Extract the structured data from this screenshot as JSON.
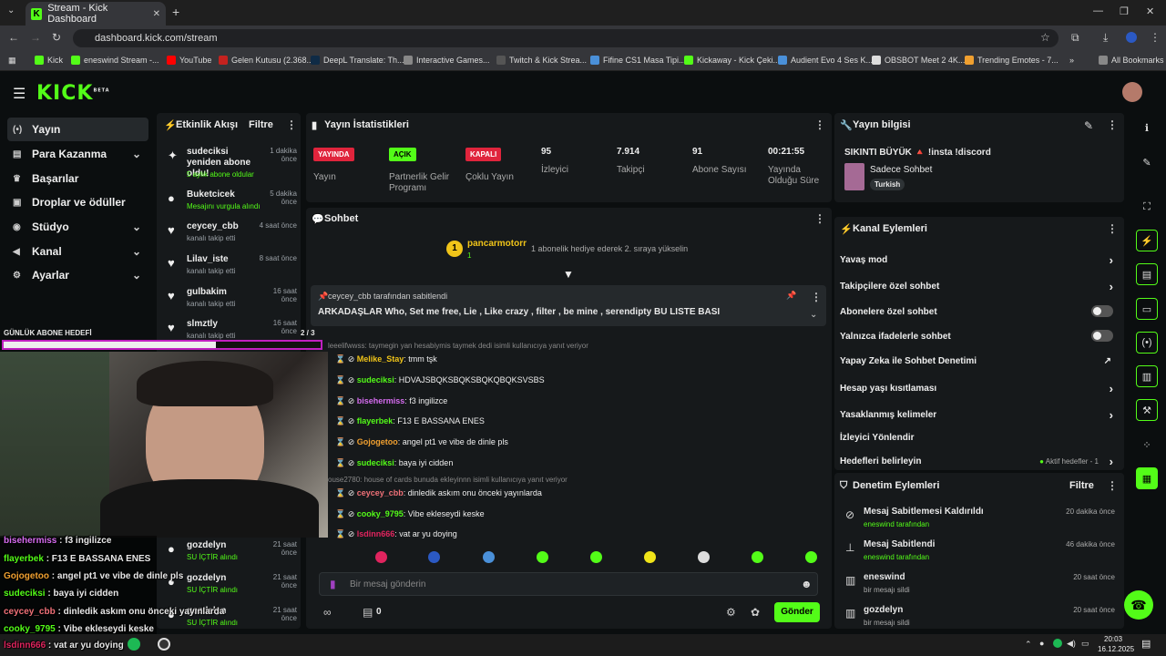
{
  "browser": {
    "tab_title": "Stream - Kick Dashboard",
    "url": "dashboard.kick.com/stream",
    "bookmarks": [
      "Kick",
      "eneswind Stream -...",
      "YouTube",
      "Gelen Kutusu (2.368...",
      "DeepL Translate: Th...",
      "Interactive Games...",
      "Twitch & Kick Strea...",
      "Fifine CS1 Masa Tipi...",
      "Kickaway - Kick Çeki...",
      "Audient Evo 4 Ses K...",
      "OBSBOT Meet 2 4K...",
      "Trending Emotes - 7..."
    ],
    "all_bookmarks": "All Bookmarks"
  },
  "logo": "KICK",
  "logo_beta": "BETA",
  "sidebar": {
    "items": [
      {
        "label": "Yayın",
        "icon": "broadcast-icon",
        "chev": ""
      },
      {
        "label": "Para Kazanma",
        "icon": "wallet-icon",
        "chev": "⌄"
      },
      {
        "label": "Başarılar",
        "icon": "trophy-icon",
        "chev": ""
      },
      {
        "label": "Droplar ve ödüller",
        "icon": "gift-icon",
        "chev": ""
      },
      {
        "label": "Stüdyo",
        "icon": "palette-icon",
        "chev": "⌄"
      },
      {
        "label": "Kanal",
        "icon": "megaphone-icon",
        "chev": "⌄"
      },
      {
        "label": "Ayarlar",
        "icon": "gear-icon",
        "chev": "⌄"
      }
    ]
  },
  "activity": {
    "title": "Etkinlik Akışı",
    "filter": "Filtre",
    "items": [
      {
        "name": "sudeciksi yeniden abone oldu!",
        "time": "1 dakika önce",
        "sub": "5 aylık abone oldular",
        "subcolor": "#53fc18"
      },
      {
        "name": "Buketcicek",
        "time": "5 dakika önce",
        "sub": "Mesajını vurgula alındı",
        "subcolor": "#53fc18"
      },
      {
        "name": "ceycey_cbb",
        "time": "4 saat önce",
        "sub": "kanalı takip etti",
        "subcolor": "#9aa0a6"
      },
      {
        "name": "Lilav_iste",
        "time": "8 saat önce",
        "sub": "kanalı takip etti",
        "subcolor": "#9aa0a6"
      },
      {
        "name": "gulbakim",
        "time": "16 saat önce",
        "sub": "kanalı takip etti",
        "subcolor": "#9aa0a6"
      },
      {
        "name": "slmztly",
        "time": "16 saat önce",
        "sub": "kanalı takip etti",
        "subcolor": "#9aa0a6"
      },
      {
        "name": "gozdelyn",
        "time": "21 saat önce",
        "sub": "SU İÇTİR alındı",
        "subcolor": "#53fc18"
      },
      {
        "name": "gozdelyn",
        "time": "21 saat önce",
        "sub": "SU İÇTİR alındı",
        "subcolor": "#53fc18"
      },
      {
        "name": "gozdelyn",
        "time": "21 saat önce",
        "sub": "SU İÇTİR alındı",
        "subcolor": "#53fc18"
      }
    ]
  },
  "stats": {
    "title": "Yayın İstatistikleri",
    "badges": [
      {
        "text": "YAYINDA",
        "label": "Yayın"
      },
      {
        "text": "AÇIK",
        "label": "Partnerlik Gelir Programı"
      },
      {
        "text": "KAPALI",
        "label": "Çoklu Yayın"
      }
    ],
    "values": [
      {
        "v": "95",
        "l": "İzleyici"
      },
      {
        "v": "7.914",
        "l": "Takipçi"
      },
      {
        "v": "91",
        "l": "Abone Sayısı"
      },
      {
        "v": "00:21:55",
        "l": "Yayında Olduğu Süre"
      }
    ]
  },
  "info": {
    "title": "Yayın bilgisi",
    "stream_title": "SIKINTI BÜYÜK 🔺 !insta !discord",
    "category": "Sadece Sohbet",
    "tag": "Turkish"
  },
  "chat": {
    "title": "Sohbet",
    "gifter": "pancarmotorr",
    "gifter_count": "1",
    "gift_text": "1 abonelik hediye ederek 2. sıraya yükselin",
    "pinned_by": "ceycey_cbb tarafından sabitlendi",
    "pinned_text": "ARKADAŞLAR Who, Set me free, Lie , Like crazy , filter , be mine , serendipty BU LISTE BASI",
    "messages": [
      {
        "user": "sudeciksi",
        "color": "#53fc18",
        "text": ": HDVAJSBQKSBQKSBQKQBQKSVSBS"
      },
      {
        "user": "Melike_Stay",
        "color": "#f0c419",
        "text": ": tmm tşk"
      },
      {
        "user": "sudeciksi",
        "color": "#53fc18",
        "text": ": HDVAJSBQKSBQKSBQKQBQKSVSBS"
      },
      {
        "user": "bisehermiss",
        "color": "#d66cf0",
        "text": ": f3 ingilizce"
      },
      {
        "user": "flayerbek",
        "color": "#53fc18",
        "text": ": F13 E BASSANA ENES"
      },
      {
        "user": "Gojogetoo",
        "color": "#f0a030",
        "text": ": angel pt1 ve vibe de dinle pls"
      },
      {
        "user": "sudeciksi",
        "color": "#53fc18",
        "text": ": baya iyi cidden"
      },
      {
        "user": "ceycey_cbb",
        "color": "#f07178",
        "text": ": dinledik askım onu önceki yayınlarda"
      },
      {
        "user": "cooky_9795",
        "color": "#53fc18",
        "text": ": Vibe ekleseydi keske"
      },
      {
        "user": "lsdinn666",
        "color": "#e0245e",
        "text": ": vat ar yu doying"
      }
    ],
    "sys1": "leeelifwwss: taymegin yan hesabiymis taymek dedi isimli kullanıcıya yanıt veriyor",
    "sys2": "ouse2780: house of cards bunuda ekleyinnn isimli kullanıcıya yanıt veriyor",
    "placeholder": "Bir mesaj gönderin",
    "points": "0",
    "send": "Gönder"
  },
  "channel_actions": {
    "title": "Kanal Eylemleri",
    "items": [
      "Yavaş mod",
      "Takipçilere özel sohbet",
      "Abonelere özel sohbet",
      "Yalnızca ifadelerle sohbet",
      "Yapay Zeka ile Sohbet Denetimi",
      "Hesap yaşı kısıtlaması",
      "Yasaklanmış kelimeler",
      "İzleyici Yönlendir",
      "Hedefleri belirleyin"
    ],
    "goals_status": "Aktif hedefler - 1"
  },
  "moderation": {
    "title": "Denetim Eylemleri",
    "filter": "Filtre",
    "items": [
      {
        "name": "Mesaj Sabitlemesi Kaldırıldı",
        "sub": "eneswind tarafından",
        "time": "20 dakika önce"
      },
      {
        "name": "Mesaj Sabitlendi",
        "sub": "eneswind tarafından",
        "time": "46 dakika önce"
      },
      {
        "name": "eneswind",
        "sub": "bir mesajı sildi",
        "time": "20 saat önce"
      },
      {
        "name": "gozdelyn",
        "sub": "bir mesajı sildi",
        "time": "20 saat önce"
      }
    ]
  },
  "overlay": {
    "goal_label": "GÜNLÜK ABONE HEDEFİ",
    "goal_count": "2 / 3",
    "goal_progress": 0.67,
    "lines": [
      {
        "user": "bisehermiss",
        "color": "#d66cf0",
        "text": " : f3 ingilizce"
      },
      {
        "user": "flayerbek",
        "color": "#53fc18",
        "text": " : F13 E BASSANA ENES"
      },
      {
        "user": "Gojogetoo",
        "color": "#f0a030",
        "text": " : angel pt1 ve vibe de dinle pls"
      },
      {
        "user": "sudeciksi",
        "color": "#53fc18",
        "text": " : baya iyi cidden"
      },
      {
        "user": "ceycey_cbb",
        "color": "#f07178",
        "text": " : dinledik askım onu önceki yayınlarda"
      },
      {
        "user": "cooky_9795",
        "color": "#53fc18",
        "text": " : Vibe ekleseydi keske"
      },
      {
        "user": "lsdinn666",
        "color": "#e0245e",
        "text": " : vat ar yu doying"
      }
    ]
  },
  "taskbar": {
    "time": "20:03",
    "date": "16.12.2025"
  }
}
